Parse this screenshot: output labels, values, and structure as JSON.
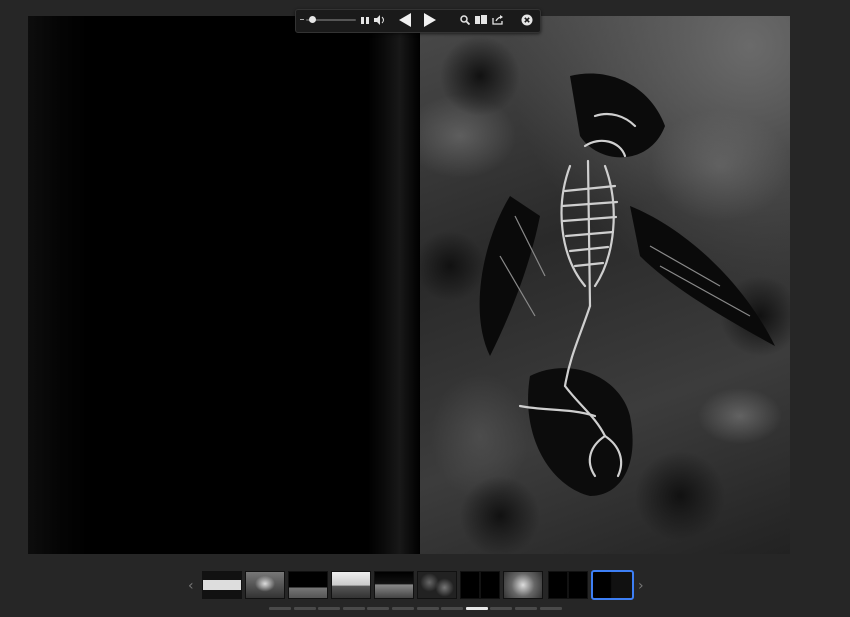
{
  "toolbar": {
    "zoom_level_fraction": 0.08,
    "buttons": [
      {
        "name": "volume",
        "icon": "speaker-icon"
      },
      {
        "name": "prev",
        "icon": "triangle-left-icon"
      },
      {
        "name": "next",
        "icon": "triangle-right-icon"
      },
      {
        "name": "search",
        "icon": "search-icon"
      },
      {
        "name": "pages",
        "icon": "book-icon"
      },
      {
        "name": "share",
        "icon": "share-icon"
      },
      {
        "name": "close",
        "icon": "close-circle-icon"
      }
    ]
  },
  "spread": {
    "left_page_color": "#000000",
    "right_page_subject": "bird-skeleton-photo"
  },
  "thumbnails": {
    "count": 11,
    "selected_index": 10,
    "accent_color": "#3d7ff5"
  },
  "page_dots": {
    "count": 12,
    "active_index": 8
  }
}
